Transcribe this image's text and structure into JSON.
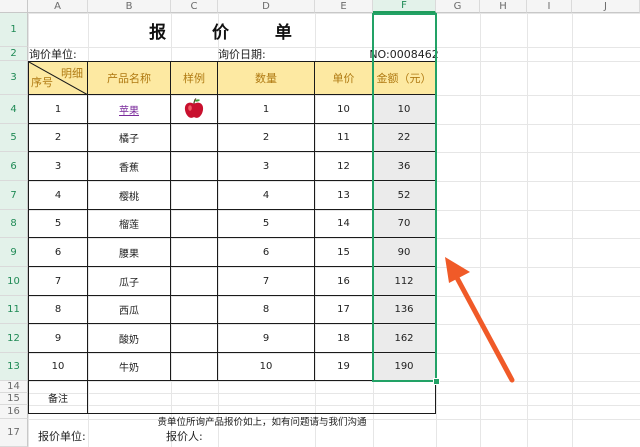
{
  "columns": [
    "A",
    "B",
    "C",
    "D",
    "E",
    "F",
    "G",
    "H",
    "I",
    "J"
  ],
  "rows": [
    "1",
    "2",
    "3",
    "4",
    "5",
    "6",
    "7",
    "8",
    "9",
    "10",
    "11",
    "12",
    "13",
    "14",
    "15",
    "16",
    "17"
  ],
  "title": "报 价 单",
  "meta": {
    "inquiry_unit": "询价单位:",
    "inquiry_date": "询价日期:",
    "number": "NO:0008462"
  },
  "table_headers": {
    "detail": "明细",
    "seq": "序号",
    "product": "产品名称",
    "sample": "样例",
    "qty": "数量",
    "price": "单价",
    "amount": "金额（元）"
  },
  "items": [
    {
      "seq": "1",
      "name": "苹果",
      "qty": "1",
      "price": "10",
      "amount": "10"
    },
    {
      "seq": "2",
      "name": "橘子",
      "qty": "2",
      "price": "11",
      "amount": "22"
    },
    {
      "seq": "3",
      "name": "香蕉",
      "qty": "3",
      "price": "12",
      "amount": "36"
    },
    {
      "seq": "4",
      "name": "樱桃",
      "qty": "4",
      "price": "13",
      "amount": "52"
    },
    {
      "seq": "5",
      "name": "榴莲",
      "qty": "5",
      "price": "14",
      "amount": "70"
    },
    {
      "seq": "6",
      "name": "腰果",
      "qty": "6",
      "price": "15",
      "amount": "90"
    },
    {
      "seq": "7",
      "name": "瓜子",
      "qty": "7",
      "price": "16",
      "amount": "112"
    },
    {
      "seq": "8",
      "name": "西瓜",
      "qty": "8",
      "price": "17",
      "amount": "136"
    },
    {
      "seq": "9",
      "name": "酸奶",
      "qty": "9",
      "price": "18",
      "amount": "162"
    },
    {
      "seq": "10",
      "name": "牛奶",
      "qty": "10",
      "price": "19",
      "amount": "190"
    }
  ],
  "remarks_label": "备注",
  "footer_note": "贵单位所询产品报价如上，如有问题请与我们沟通",
  "footer": {
    "quote_unit": "报价单位:",
    "quoter": "报价人:"
  },
  "sample_icon": "apple-icon",
  "colors": {
    "header_fill": "#fde9a2",
    "selection": "#22a266",
    "arrow": "#f05a28"
  }
}
